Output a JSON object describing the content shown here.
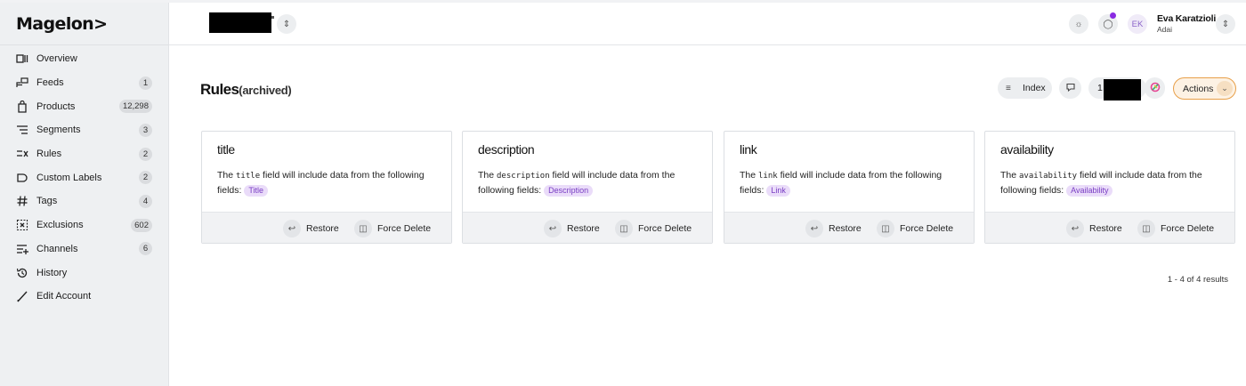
{
  "brand": {
    "logo_text": "Magelon>"
  },
  "sidebar": {
    "items": [
      {
        "label": "Overview",
        "badge": "",
        "icon": "overview-icon"
      },
      {
        "label": "Feeds",
        "badge": "1",
        "icon": "feeds-icon"
      },
      {
        "label": "Products",
        "badge": "12,298",
        "icon": "products-icon"
      },
      {
        "label": "Segments",
        "badge": "3",
        "icon": "segments-icon"
      },
      {
        "label": "Rules",
        "badge": "2",
        "icon": "rules-icon"
      },
      {
        "label": "Custom Labels",
        "badge": "2",
        "icon": "label-icon"
      },
      {
        "label": "Tags",
        "badge": "4",
        "icon": "hash-icon"
      },
      {
        "label": "Exclusions",
        "badge": "602",
        "icon": "exclusions-icon"
      },
      {
        "label": "Channels",
        "badge": "6",
        "icon": "channels-icon"
      },
      {
        "label": "History",
        "badge": "",
        "icon": "history-icon"
      },
      {
        "label": "Edit Account",
        "badge": "",
        "icon": "pencil-icon"
      }
    ]
  },
  "header": {
    "user_initials": "EK",
    "user_name": "Eva Karatzioli",
    "user_org": "Adai"
  },
  "page": {
    "title": "Rules",
    "title_suffix": "(archived)"
  },
  "toolbar": {
    "index_label": "Index",
    "count_visible": "1",
    "actions_label": "Actions"
  },
  "cards": [
    {
      "title": "title",
      "text_before": "The ",
      "code": "title",
      "text_after": " field will include data from the following fields: ",
      "pill": "Title",
      "restore_label": "Restore",
      "delete_label": "Force Delete"
    },
    {
      "title": "description",
      "text_before": "The ",
      "code": "description",
      "text_after": " field will include data from the following fields: ",
      "pill": "Description",
      "restore_label": "Restore",
      "delete_label": "Force Delete"
    },
    {
      "title": "link",
      "text_before": "The ",
      "code": "link",
      "text_after": " field will include data from the following fields: ",
      "pill": "Link",
      "restore_label": "Restore",
      "delete_label": "Force Delete"
    },
    {
      "title": "availability",
      "text_before": "The ",
      "code": "availability",
      "text_after": " field will include data from the following fields: ",
      "pill": "Availability",
      "restore_label": "Restore",
      "delete_label": "Force Delete"
    }
  ],
  "results_text": "1 - 4 of 4 results",
  "colors": {
    "accent_purple": "#8a2be2",
    "pill_bg": "#eadcf9",
    "actions_border": "#e8a04a"
  }
}
